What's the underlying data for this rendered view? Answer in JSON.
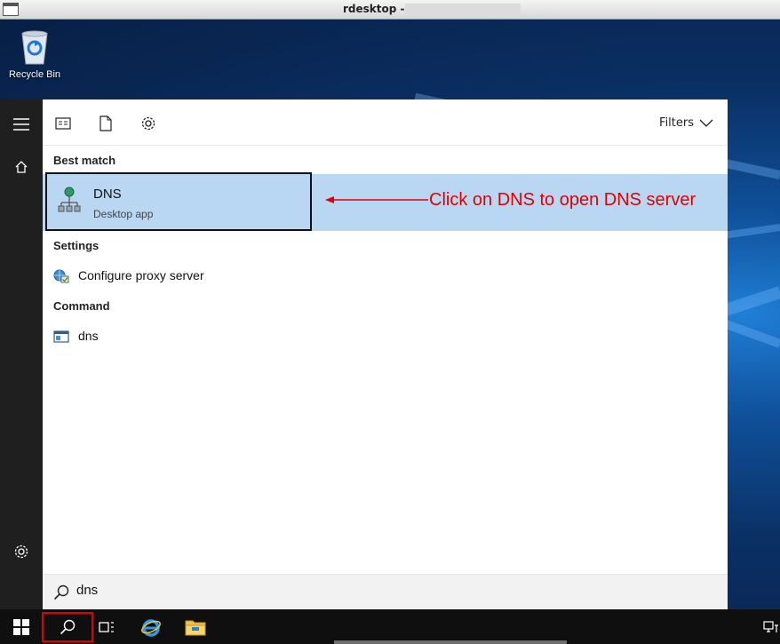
{
  "window": {
    "title": "rdesktop -"
  },
  "desktop": {
    "icons": [
      {
        "label": "Recycle Bin",
        "icon": "recycle-bin-icon"
      }
    ]
  },
  "start_panel": {
    "toolbar": {
      "filters_label": "Filters"
    },
    "sections": {
      "best_match": "Best match",
      "settings": "Settings",
      "command": "Command"
    },
    "best_match_item": {
      "name": "DNS",
      "subtitle": "Desktop app",
      "icon": "dns-app-icon"
    },
    "settings_items": [
      {
        "label": "Configure proxy server",
        "icon": "proxy-settings-icon"
      }
    ],
    "command_items": [
      {
        "label": "dns",
        "icon": "command-window-icon"
      }
    ],
    "search": {
      "value": "dns"
    }
  },
  "annotation": {
    "text": "Click on DNS to open DNS server",
    "color": "#e00000"
  },
  "colors": {
    "highlight": "#b9d7f3",
    "rail": "#1f1f1f",
    "taskbar": "#0f0f0f"
  }
}
